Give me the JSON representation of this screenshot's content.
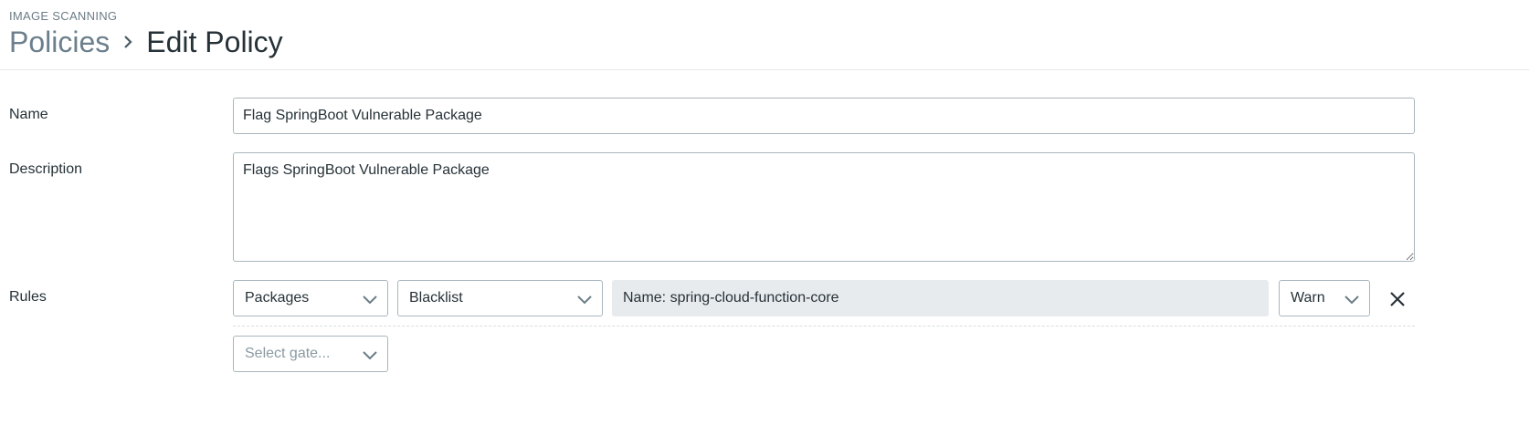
{
  "header": {
    "section_label": "IMAGE SCANNING",
    "breadcrumb_parent": "Policies",
    "breadcrumb_current": "Edit Policy",
    "separator_icon": "chevron-right-icon"
  },
  "form": {
    "name_label": "Name",
    "name_value": "Flag SpringBoot Vulnerable Package",
    "description_label": "Description",
    "description_value": "Flags SpringBoot Vulnerable Package",
    "rules_label": "Rules"
  },
  "rules": [
    {
      "gate": "Packages",
      "trigger": "Blacklist",
      "parameters": "Name: spring-cloud-function-core",
      "action": "Warn",
      "remove_icon": "close-icon"
    }
  ],
  "new_rule": {
    "gate_placeholder": "Select gate..."
  },
  "colors": {
    "text": "#263238",
    "muted": "#6b7f8c",
    "border": "#a9b6bd",
    "readonly_bg": "#e8ebee"
  }
}
